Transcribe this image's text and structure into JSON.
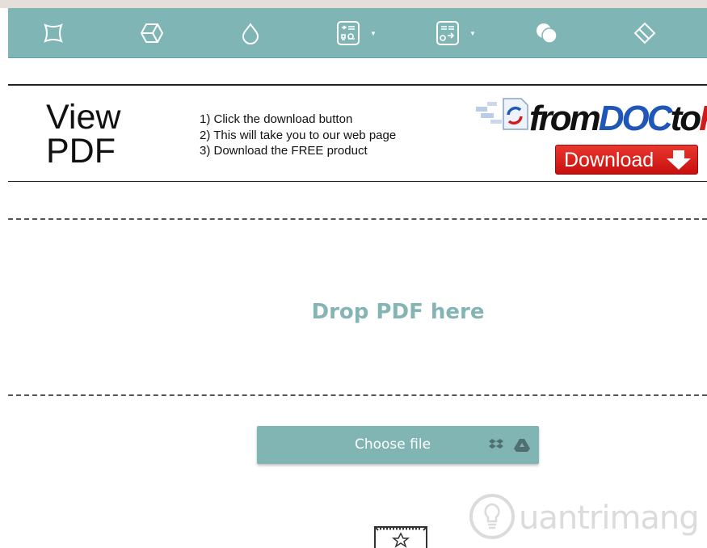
{
  "toolbar": {
    "tools": [
      {
        "name": "distort-icon"
      },
      {
        "name": "cube-icon"
      },
      {
        "name": "drop-icon"
      },
      {
        "name": "split-icon",
        "has_dropdown": true
      },
      {
        "name": "convert-icon",
        "has_dropdown": true
      },
      {
        "name": "circles-icon"
      },
      {
        "name": "eraser-icon"
      }
    ],
    "background": "#7fb5b5"
  },
  "ad": {
    "title_line1": "View",
    "title_line2": "PDF",
    "steps": [
      "1) Click the download button",
      "2) This will take you to our web page",
      "3) Download the FREE product"
    ],
    "brand_part1": "from",
    "brand_part2": "DOC",
    "brand_part3": "to",
    "brand_part4": "P",
    "download_label": "Download"
  },
  "dropzone": {
    "text": "Drop PDF here"
  },
  "upload": {
    "choose_label": "Choose file",
    "dropbox_icon": "dropbox-icon",
    "drive_icon": "google-drive-icon",
    "button_color": "#80b5b3"
  },
  "watermark": {
    "text": "uantrimang"
  }
}
